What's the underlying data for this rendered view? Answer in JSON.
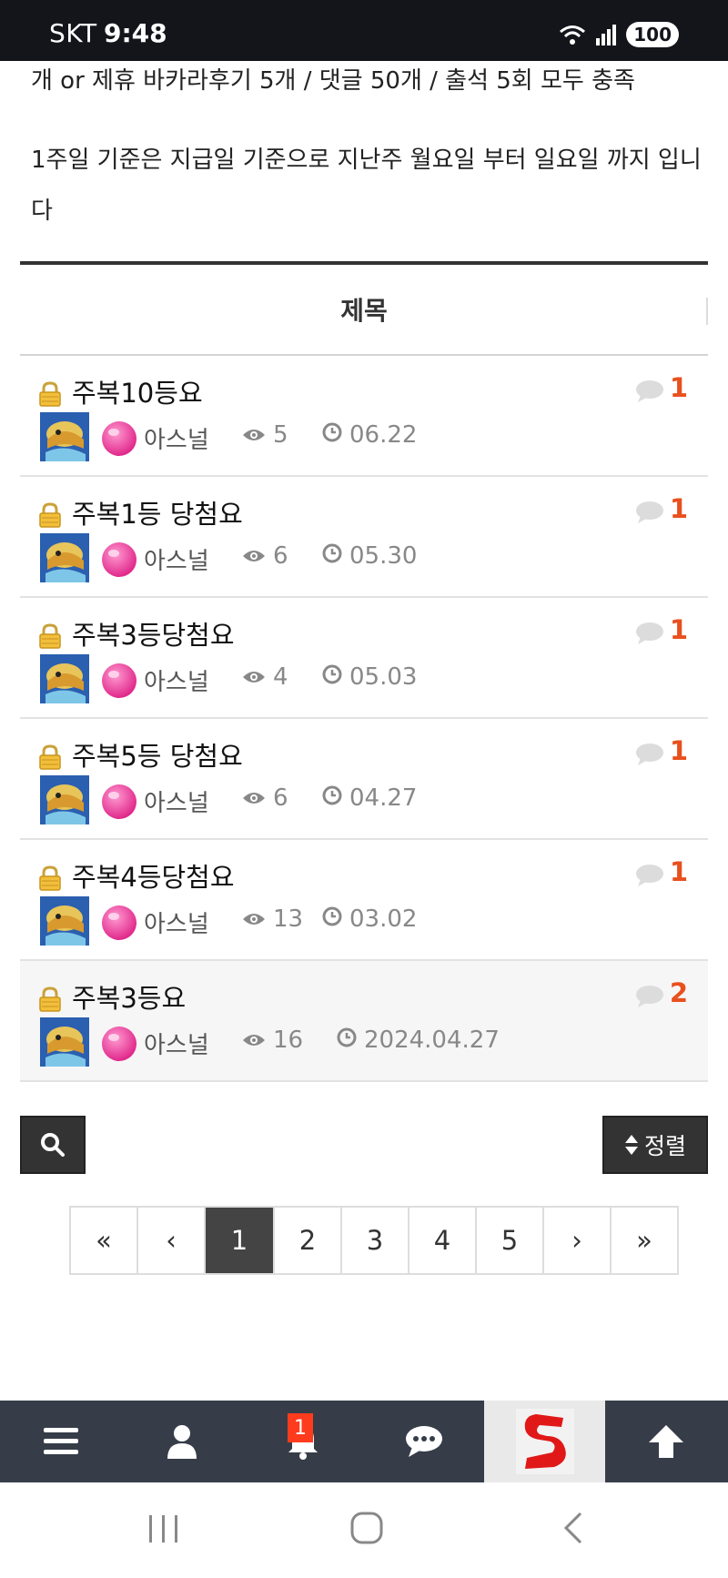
{
  "status_bar": {
    "carrier": "SKT",
    "time": "9:48",
    "battery": "100"
  },
  "notice": {
    "line1": "개 or 제휴 바카라후기 5개 / 댓글 50개 / 출석 5회 모두 충족",
    "line2": "1주일 기준은 지급일 기준으로 지난주 월요일 부터 일요일 까지 입니다"
  },
  "board": {
    "header_title": "제목",
    "posts": [
      {
        "subject": "주복10등요",
        "comments": "1",
        "author": "아스널",
        "views": "5",
        "date": "06.22"
      },
      {
        "subject": "주복1등 당첨요",
        "comments": "1",
        "author": "아스널",
        "views": "6",
        "date": "05.30"
      },
      {
        "subject": "주복3등당첨요",
        "comments": "1",
        "author": "아스널",
        "views": "4",
        "date": "05.03"
      },
      {
        "subject": "주복5등 당첨요",
        "comments": "1",
        "author": "아스널",
        "views": "6",
        "date": "04.27"
      },
      {
        "subject": "주복4등당첨요",
        "comments": "1",
        "author": "아스널",
        "views": "13",
        "date": "03.02"
      },
      {
        "subject": "주복3등요",
        "comments": "2",
        "author": "아스널",
        "views": "16",
        "date": "2024.04.27"
      }
    ]
  },
  "toolbar": {
    "sort_label": "정렬"
  },
  "pagination": {
    "first": "«",
    "prev": "‹",
    "pages": [
      "1",
      "2",
      "3",
      "4",
      "5"
    ],
    "current": "1",
    "next": "›",
    "last": "»"
  },
  "bottom_nav": {
    "notification_count": "1"
  },
  "colors": {
    "accent": "#e8501e",
    "dark": "#333333",
    "nav_bg": "#363d49",
    "badge": "#ff3b1e"
  }
}
